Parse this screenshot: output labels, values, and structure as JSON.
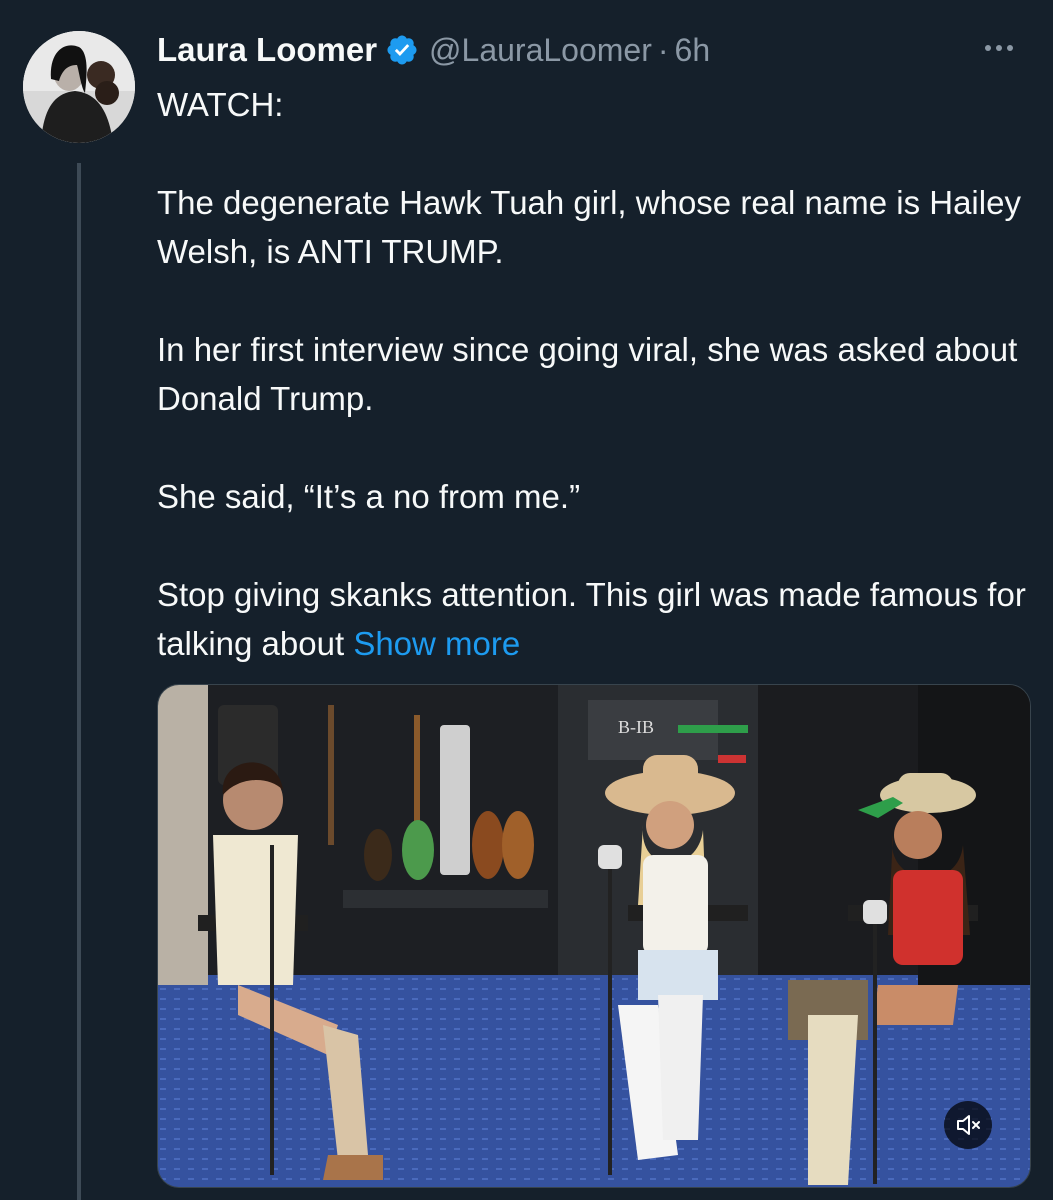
{
  "tweet": {
    "author": {
      "display_name": "Laura Loomer",
      "handle": "@LauraLoomer",
      "verified": true
    },
    "separator": "·",
    "time": "6h",
    "paragraphs": [
      "WATCH:",
      "The degenerate Hawk Tuah girl, whose real name is Hailey Welsh, is ANTI TRUMP.",
      "In her first interview since going viral, she was asked about Donald Trump.",
      "She said, “It’s a no from me.”"
    ],
    "last_paragraph": "Stop giving skanks attention. This girl was made famous for talking about",
    "show_more": "Show more",
    "media": {
      "type": "video",
      "sign_text": "B-IB",
      "muted": true
    }
  },
  "colors": {
    "background": "#15202b",
    "text": "#f7f9f9",
    "secondary": "#8b98a5",
    "link": "#1d9bf0",
    "verified": "#1d9bf0"
  },
  "icons": [
    "verified-badge-icon",
    "more-options-icon",
    "volume-muted-icon"
  ]
}
